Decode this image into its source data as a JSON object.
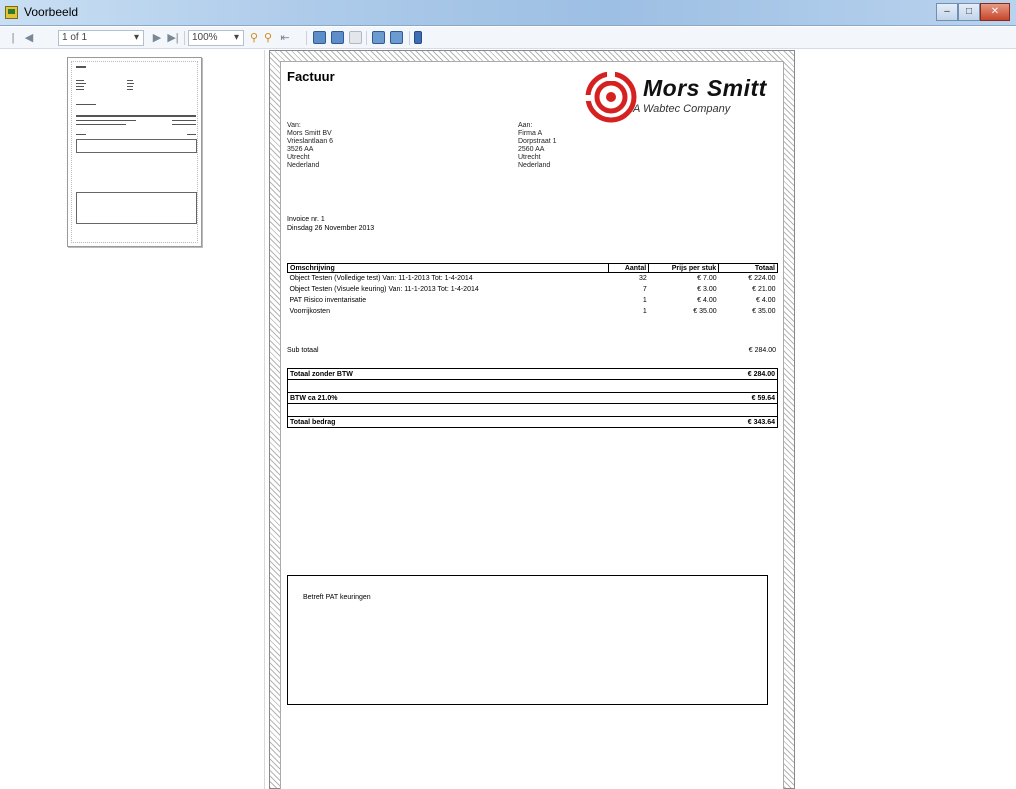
{
  "window": {
    "title": "Voorbeeld",
    "buttons": [
      "minimize",
      "maximize",
      "close"
    ]
  },
  "toolbar": {
    "page_indicator": "1 of 1",
    "zoom": "100%"
  },
  "invoice": {
    "title": "Factuur",
    "logo": {
      "name": "Mors Smitt",
      "tagline": "A Wabtec Company"
    },
    "from": {
      "label": "Van:",
      "lines": [
        "Mors Smitt BV",
        "Vrieslantlaan 6",
        "3526 AA",
        "Utrecht",
        "Nederland"
      ]
    },
    "to": {
      "label": "Aan:",
      "lines": [
        "Firma A",
        "Dorpstraat 1",
        "2560 AA",
        "Utrecht",
        "Nederland"
      ]
    },
    "invoice_number": "Invoice nr. 1",
    "date": "Dinsdag 26 November 2013",
    "columns": [
      "Omschrijving",
      "Aantal",
      "Prijs per stuk",
      "Totaal"
    ],
    "lines": [
      {
        "description": "Object Testen (Volledige test)  Van: 11-1-2013  Tot: 1-4-2014",
        "qty": "32",
        "price": "€ 7.00",
        "total": "€ 224.00"
      },
      {
        "description": "Object Testen (Visuele keuring)  Van: 11-1-2013  Tot: 1-4-2014",
        "qty": "7",
        "price": "€ 3.00",
        "total": "€ 21.00"
      },
      {
        "description": "PAT Risico inventarisatie",
        "qty": "1",
        "price": "€ 4.00",
        "total": "€ 4.00"
      },
      {
        "description": "Voorrijkosten",
        "qty": "1",
        "price": "€ 35.00",
        "total": "€ 35.00"
      }
    ],
    "subtotal_label": "Sub totaal",
    "subtotal_value": "€ 284.00",
    "total_excl_label": "Totaal zonder BTW",
    "total_excl_value": "€ 284.00",
    "vat_label": "BTW ca 21.0%",
    "vat_value": "€ 59.64",
    "total_label": "Totaal bedrag",
    "total_value": "€ 343.64",
    "notes": "Betreft PAT keuringen"
  }
}
